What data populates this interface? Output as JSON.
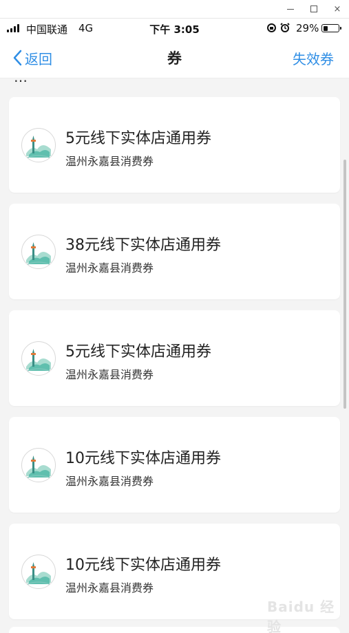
{
  "window": {
    "minimize_icon": "minimize-icon",
    "maximize_icon": "maximize-icon",
    "close_label": "×"
  },
  "status_bar": {
    "carrier": "中国联通",
    "network": "4G",
    "time": "下午 3:05",
    "battery_percent": "29%",
    "battery_level": 0.29
  },
  "nav": {
    "back_label": "返回",
    "title": "券",
    "right_label": "失效券"
  },
  "colors": {
    "accent": "#2f8ee5",
    "background": "#f4f4f4",
    "card": "#ffffff"
  },
  "coupons": [
    {
      "title": "5元线下实体店通用券",
      "subtitle": "温州永嘉县消费券"
    },
    {
      "title": "38元线下实体店通用券",
      "subtitle": "温州永嘉县消费券"
    },
    {
      "title": "5元线下实体店通用券",
      "subtitle": "温州永嘉县消费券"
    },
    {
      "title": "10元线下实体店通用券",
      "subtitle": "温州永嘉县消费券"
    },
    {
      "title": "10元线下实体店通用券",
      "subtitle": "温州永嘉县消费券"
    }
  ],
  "watermark": "Baidu 经验"
}
